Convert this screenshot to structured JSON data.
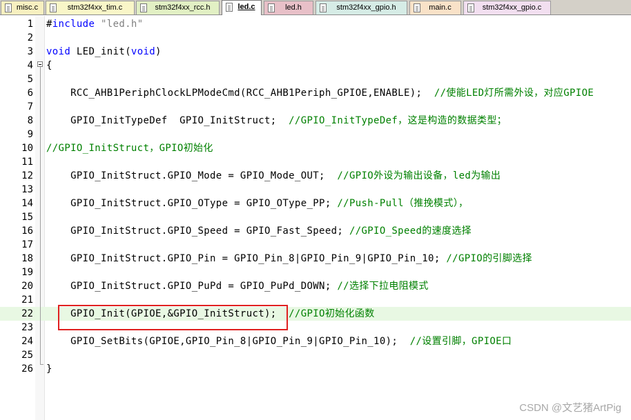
{
  "tabs": [
    {
      "label": "misc.c",
      "color": "#f7f0c0",
      "active": false
    },
    {
      "label": "stm32f4xx_tim.c",
      "color": "#f9f6c8",
      "active": false
    },
    {
      "label": "stm32f4xx_rcc.h",
      "color": "#e2f0c4",
      "active": false
    },
    {
      "label": "led.c",
      "color": "#ffffff",
      "active": true
    },
    {
      "label": "led.h",
      "color": "#e8c0c8",
      "active": false
    },
    {
      "label": "stm32f4xx_gpio.h",
      "color": "#d6ece6",
      "active": false
    },
    {
      "label": "main.c",
      "color": "#f9e2c8",
      "active": false
    },
    {
      "label": "stm32f4xx_gpio.c",
      "color": "#f2dff0",
      "active": false
    }
  ],
  "editor": {
    "current_line": 22,
    "lines": [
      {
        "n": "1",
        "text": "#include \"led.h\""
      },
      {
        "n": "2",
        "text": ""
      },
      {
        "n": "3",
        "text": "void LED_init(void)"
      },
      {
        "n": "4",
        "text": "{"
      },
      {
        "n": "5",
        "text": ""
      },
      {
        "n": "6",
        "text": "    RCC_AHB1PeriphClockLPModeCmd(RCC_AHB1Periph_GPIOE,ENABLE);  //使能LED灯所需外设，对应GPIOE"
      },
      {
        "n": "7",
        "text": ""
      },
      {
        "n": "8",
        "text": "    GPIO_InitTypeDef  GPIO_InitStruct;  //GPIO_InitTypeDef，这是构造的数据类型；"
      },
      {
        "n": "9",
        "text": ""
      },
      {
        "n": "10",
        "text": "//GPIO_InitStruct，GPIO初始化"
      },
      {
        "n": "11",
        "text": ""
      },
      {
        "n": "12",
        "text": "    GPIO_InitStruct.GPIO_Mode = GPIO_Mode_OUT;  //GPIO外设为输出设备，led为输出"
      },
      {
        "n": "13",
        "text": ""
      },
      {
        "n": "14",
        "text": "    GPIO_InitStruct.GPIO_OType = GPIO_OType_PP; //Push-Pull（推挽模式），"
      },
      {
        "n": "15",
        "text": ""
      },
      {
        "n": "16",
        "text": "    GPIO_InitStruct.GPIO_Speed = GPIO_Fast_Speed; //GPIO_Speed的速度选择"
      },
      {
        "n": "17",
        "text": ""
      },
      {
        "n": "18",
        "text": "    GPIO_InitStruct.GPIO_Pin = GPIO_Pin_8|GPIO_Pin_9|GPIO_Pin_10; //GPIO的引脚选择"
      },
      {
        "n": "19",
        "text": ""
      },
      {
        "n": "20",
        "text": "    GPIO_InitStruct.GPIO_PuPd = GPIO_PuPd_DOWN; //选择下拉电阻模式"
      },
      {
        "n": "21",
        "text": ""
      },
      {
        "n": "22",
        "text": "    GPIO_Init(GPIOE,&GPIO_InitStruct);  //GPIO初始化函数"
      },
      {
        "n": "23",
        "text": ""
      },
      {
        "n": "24",
        "text": "    GPIO_SetBits(GPIOE,GPIO_Pin_8|GPIO_Pin_9|GPIO_Pin_10);  //设置引脚，GPIOE口"
      },
      {
        "n": "25",
        "text": ""
      },
      {
        "n": "26",
        "text": "}"
      }
    ]
  },
  "colors": {
    "keyword": "#0000ff",
    "string": "#808080",
    "comment": "#008000",
    "current_line_bg": "#e8f8e3",
    "annotation_box": "#e02020"
  },
  "watermark": "CSDN @文艺猪ArtPig"
}
